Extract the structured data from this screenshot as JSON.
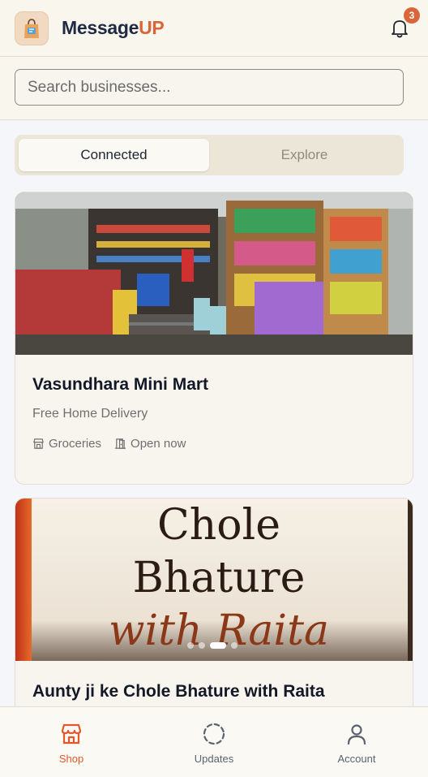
{
  "header": {
    "brand_part1": "Message",
    "brand_part2": "UP",
    "notification_count": "3"
  },
  "search": {
    "placeholder": "Search businesses..."
  },
  "tabs": [
    {
      "label": "Connected",
      "active": true
    },
    {
      "label": "Explore",
      "active": false
    }
  ],
  "businesses": [
    {
      "name": "Vasundhara Mini Mart",
      "tagline": "Free Home Delivery",
      "category": "Groceries",
      "status": "Open now"
    },
    {
      "name": "Aunty ji ke Chole Bhature with Raita",
      "image_text_line1": "Chole",
      "image_text_line2": "Bhature",
      "image_text_line3": "with Raita"
    }
  ],
  "carousel": {
    "slide_count": 4,
    "active_index": 2
  },
  "bottom_nav": [
    {
      "label": "Shop",
      "icon": "store-icon",
      "active": true
    },
    {
      "label": "Updates",
      "icon": "dashed-circle-icon",
      "active": false
    },
    {
      "label": "Account",
      "icon": "user-icon",
      "active": false
    }
  ],
  "colors": {
    "accent": "#d9663a",
    "active_nav": "#e2572b",
    "brand_dark": "#1f2a44"
  }
}
